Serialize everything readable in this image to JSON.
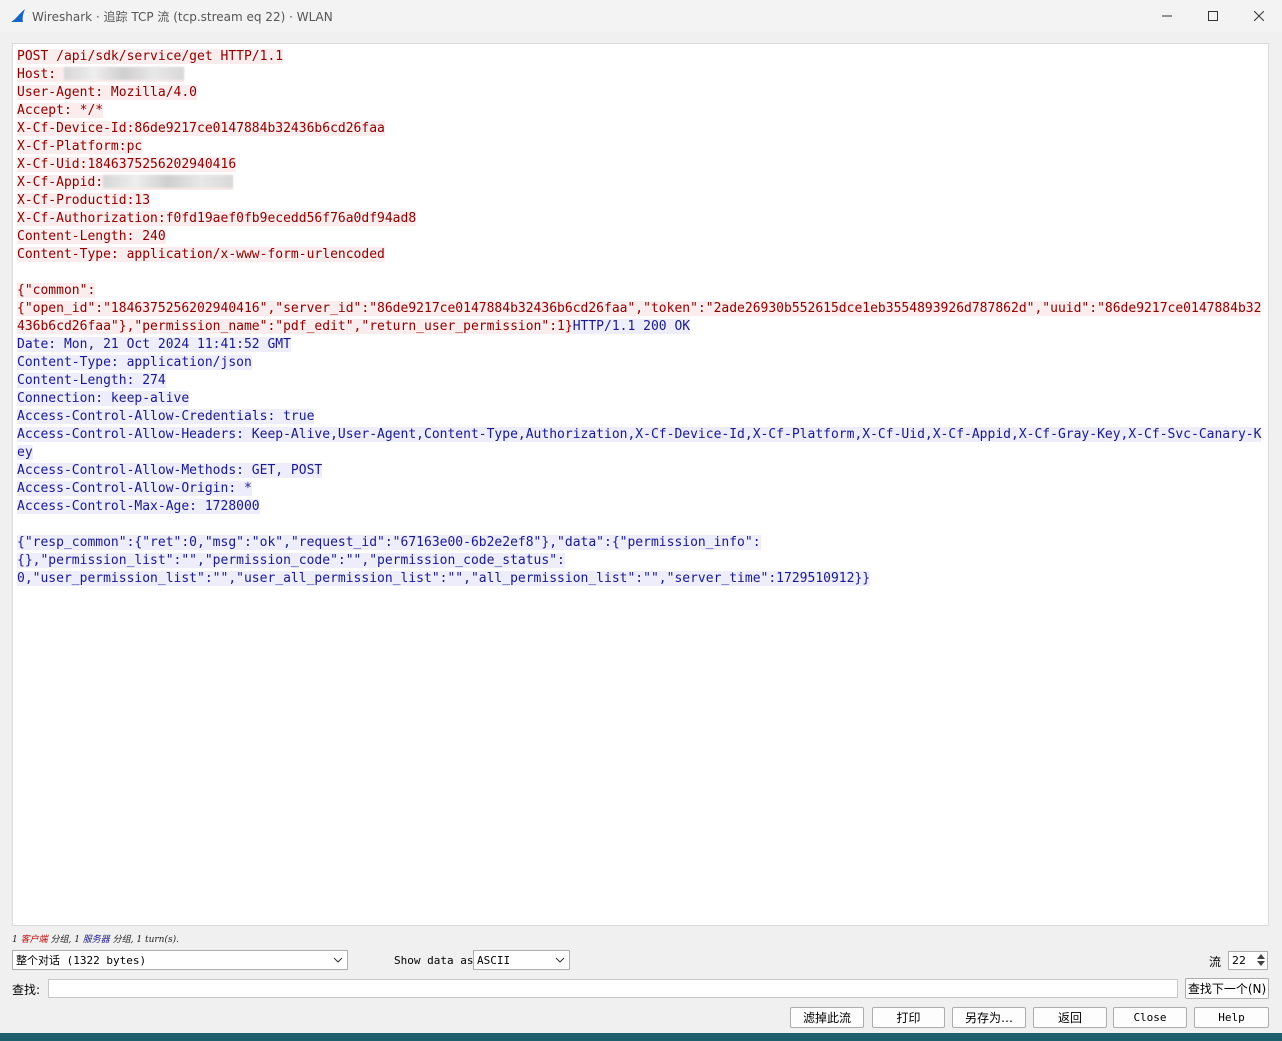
{
  "window": {
    "title": "Wireshark · 追踪 TCP 流 (tcp.stream eq 22) · WLAN",
    "icon": "wireshark-fin-icon"
  },
  "stream": {
    "client_request": [
      "POST /api/sdk/service/get HTTP/1.1",
      "Host: ",
      "User-Agent: Mozilla/4.0",
      "Accept: */*",
      "X-Cf-Device-Id:86de9217ce0147884b32436b6cd26faa",
      "X-Cf-Platform:pc",
      "X-Cf-Uid:1846375256202940416",
      "X-Cf-Appid:",
      "X-Cf-Productid:13",
      "X-Cf-Authorization:f0fd19aef0fb9ecedd56f76a0df94ad8",
      "Content-Length: 240",
      "Content-Type: application/x-www-form-urlencoded"
    ],
    "client_body": "{\"common\":\n{\"open_id\":\"1846375256202940416\",\"server_id\":\"86de9217ce0147884b32436b6cd26faa\",\"token\":\"2ade26930b552615dce1eb3554893926d787862d\",\"uuid\":\"86de9217ce0147884b32436b6cd26faa\"},\"permission_name\":\"pdf_edit\",\"return_user_permission\":1}",
    "server_status": "HTTP/1.1 200 OK",
    "server_headers": [
      "Date: Mon, 21 Oct 2024 11:41:52 GMT",
      "Content-Type: application/json",
      "Content-Length: 274",
      "Connection: keep-alive",
      "Access-Control-Allow-Credentials: true",
      "Access-Control-Allow-Headers: Keep-Alive,User-Agent,Content-Type,Authorization,X-Cf-Device-Id,X-Cf-Platform,X-Cf-Uid,X-Cf-Appid,X-Cf-Gray-Key,X-Cf-Svc-Canary-Key",
      "Access-Control-Allow-Methods: GET, POST",
      "Access-Control-Allow-Origin: *",
      "Access-Control-Max-Age: 1728000"
    ],
    "server_body": "{\"resp_common\":{\"ret\":0,\"msg\":\"ok\",\"request_id\":\"67163e00-6b2e2ef8\"},\"data\":{\"permission_info\":\n{},\"permission_list\":\"\",\"permission_code\":\"\",\"permission_code_status\":\n0,\"user_permission_list\":\"\",\"user_all_permission_list\":\"\",\"all_permission_list\":\"\",\"server_time\":1729510912}}",
    "colors": {
      "client_fg": "#8b0000",
      "client_bg": "#fbeded",
      "server_fg": "#1a1a8c",
      "server_bg": "#ededfb"
    }
  },
  "summary": {
    "p1": "1 ",
    "client": "客户端",
    "p2": " 分组, 1 ",
    "server": "服务器",
    "p3": " 分组, 1 turn(s)."
  },
  "controls": {
    "conversation_select": "整个对话 (1322 bytes)",
    "show_data_label": "Show data as",
    "show_data_value": "ASCII",
    "stream_label": "流",
    "stream_value": "22",
    "find_label": "查找:",
    "find_value": "",
    "find_next": "查找下一个(N)"
  },
  "buttons": {
    "filter_out": "滤掉此流",
    "print": "打印",
    "save_as": "另存为…",
    "back": "返回",
    "close": "Close",
    "help": "Help"
  }
}
